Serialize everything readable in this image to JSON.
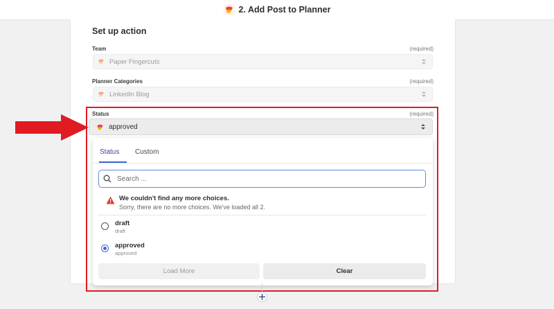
{
  "header": {
    "title": "2. Add Post to Planner",
    "app_icon": "app-logo-icon"
  },
  "panel": {
    "section_title": "Set up action",
    "fields": [
      {
        "label": "Team",
        "required": "(required)",
        "value": "Paper Fingercuts"
      },
      {
        "label": "Planner Categories",
        "required": "(required)",
        "value": "LinkedIn Blog"
      }
    ],
    "status": {
      "label": "Status",
      "required": "(required)",
      "value": "approved"
    }
  },
  "dropdown": {
    "tabs": [
      {
        "label": "Status",
        "active": true
      },
      {
        "label": "Custom",
        "active": false
      }
    ],
    "search": {
      "placeholder": "Search ...",
      "value": ""
    },
    "notice": {
      "title": "We couldn't find any more choices.",
      "subtitle": "Sorry, there are no more choices. We've loaded all 2."
    },
    "options": [
      {
        "label": "draft",
        "sub": "draft",
        "selected": false
      },
      {
        "label": "approved",
        "sub": "approved",
        "selected": true
      }
    ],
    "buttons": {
      "load_more": "Load More",
      "clear": "Clear"
    }
  },
  "colors": {
    "accent": "#3d67d6",
    "highlight": "#e01b24",
    "warning": "#d9412f"
  }
}
